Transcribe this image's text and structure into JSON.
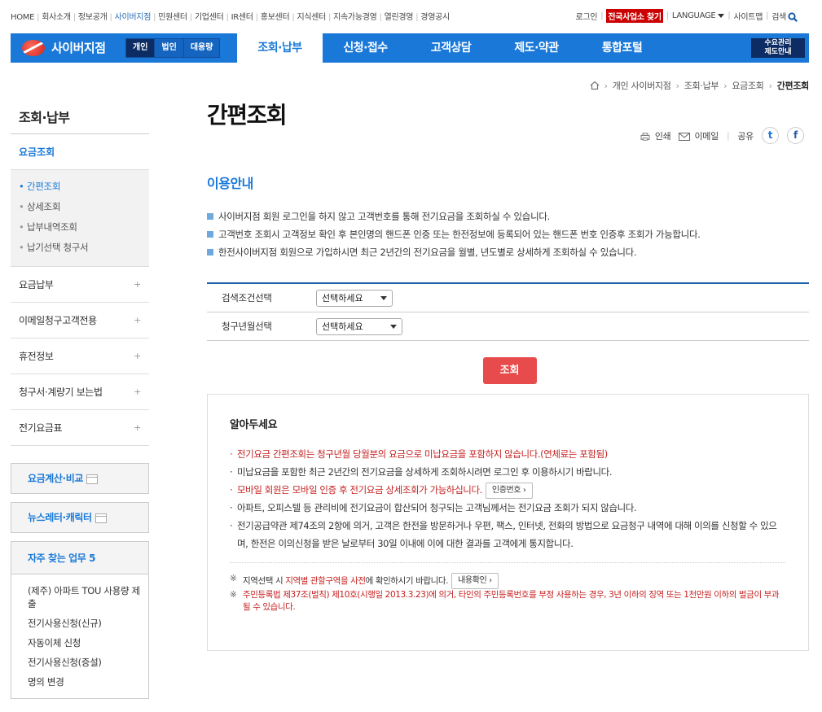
{
  "util_nav": {
    "left": [
      "HOME",
      "회사소개",
      "정보공개",
      "사이버지점",
      "민원센터",
      "기업센터",
      "IR센터",
      "홍보센터",
      "지식센터",
      "지속가능경영",
      "열린경영",
      "경영공시"
    ],
    "right": {
      "login": "로그인",
      "office_finder": "전국사업소 찾기",
      "language": "LANGUAGE",
      "sitemap": "사이트맵",
      "search": "검색"
    }
  },
  "gnb": {
    "logo": "사이버지점",
    "segments": [
      "개인",
      "법인",
      "대용량"
    ],
    "nav": [
      "조회·납부",
      "신청·접수",
      "고객상담",
      "제도·약관",
      "통합포털"
    ],
    "demand_line1": "수요관리",
    "demand_line2": "제도안내"
  },
  "breadcrumb": [
    "개인 사이버지점",
    "조회·납부",
    "요금조회",
    "간편조회"
  ],
  "sidebar": {
    "title": "조회·납부",
    "sub": "요금조회",
    "sublist": [
      "간편조회",
      "상세조회",
      "납부내역조회",
      "납기선택 청구서"
    ],
    "menu": [
      "요금납부",
      "이메일청구고객전용",
      "휴전정보",
      "청구서·계량기 보는법",
      "전기요금표"
    ],
    "box1": "요금계산·비교",
    "box2": "뉴스레터·캐릭터",
    "freq_title": "자주 찾는 업무 5",
    "freq": [
      "(제주) 아파트 TOU 사용량 제출",
      "전기사용신청(신규)",
      "자동이체 신청",
      "전기사용신청(증설)",
      "명의 변경"
    ]
  },
  "content": {
    "title": "간편조회",
    "tools": {
      "print": "인쇄",
      "email": "이메일",
      "share": "공유",
      "twitter": "t",
      "facebook": "f"
    },
    "section_title": "이용안내",
    "guide": [
      "사이버지점 회원 로그인을 하지 않고 고객번호를 통해 전기요금을 조회하실 수 있습니다.",
      "고객번호 조회시 고객정보 확인 후 본인명의 핸드폰 인증 또는 한전정보에 등록되어 있는 핸드폰 번호 인증후 조회가 가능합니다.",
      "한전사이버지점 회원으로 가입하시면 최근 2년간의 전기요금을 월별, 년도별로 상세하게 조회하실 수 있습니다."
    ],
    "search": {
      "label1": "검색조건선택",
      "select1": "선택하세요",
      "label2": "청구년월선택",
      "select2": "선택하세요"
    },
    "query_button": "조회",
    "notice": {
      "title": "알아두세요",
      "items": [
        "전기요금 간편조회는 청구년월 당월분의 요금으로 미납요금을 포함하지 않습니다.(연체료는 포함됨)",
        "미납요금을 포함한 최근 2년간의 전기요금을 상세하게 조회하시려면 로그인 후 이용하시기 바랍니다.",
        "모바일 회원은 모바일 인증 후 전기요금 상세조회가 가능하십니다.",
        "아파트, 오피스텔 등 관리비에 전기요금이 합산되어 청구되는 고객님께서는 전기요금 조회가 되지 않습니다.",
        "전기공급약관 제74조의 2항에 의거, 고객은 한전을 방문하거나 우편, 팩스, 인터넷, 전화의 방법으로 요금청구 내역에 대해 이의를 신청할 수 있으며, 한전은 이의신청을 받은 날로부터 30일 이내에 이에 대한 결과를 고객에게 통지합니다."
      ],
      "auth_button": "인증번호",
      "fine1_pre": "지역선택 시 ",
      "fine1_hl": "지역별 관할구역을 사전",
      "fine1_post": "에 확인하시기 바랍니다.",
      "confirm_button": "내용확인",
      "fine2": "주민등록법 제37조(벌칙) 제10호(시행일 2013.3.23)에 의거, 타인의 주민등록번호를 부정 사용하는 경우, 3년 이하의 징역 또는 1천만원 이하의 벌금이 부과될 수 있습니다."
    }
  }
}
